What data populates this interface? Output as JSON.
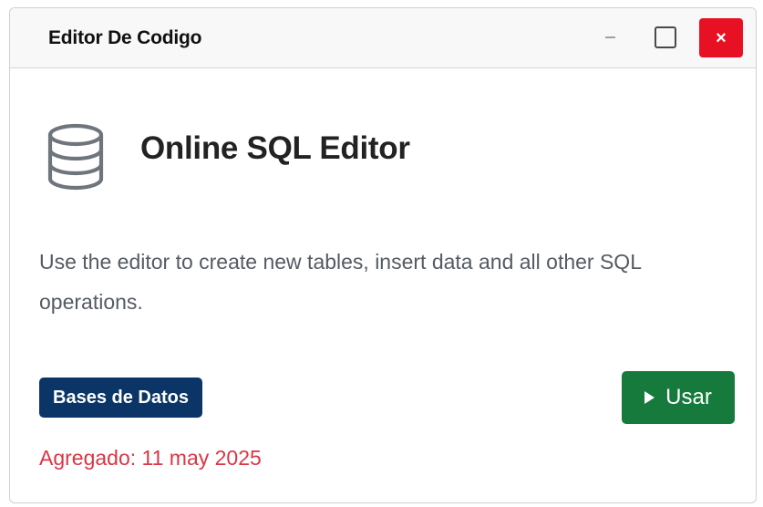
{
  "window": {
    "title": "Editor De Codigo",
    "close_label": "×"
  },
  "card": {
    "icon": "database-icon",
    "title": "Online SQL Editor",
    "description": "Use the editor to create new tables, insert data and all other SQL operations.",
    "category": "Bases de Datos",
    "use_label": "Usar",
    "added": "Agregado: 11 may 2025"
  },
  "colors": {
    "close": "#e81123",
    "badge": "#0b3566",
    "use_button": "#157a3c",
    "date": "#dc3545"
  }
}
